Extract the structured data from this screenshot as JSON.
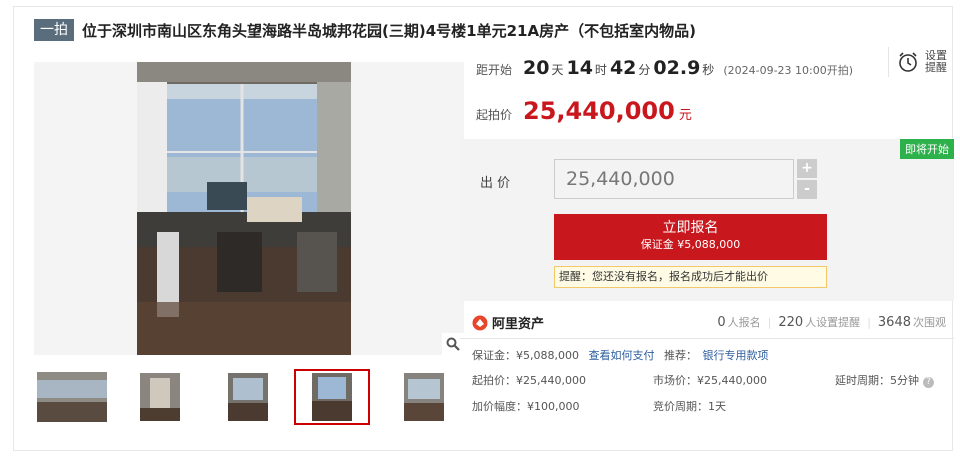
{
  "header": {
    "badge": "一拍",
    "title": "位于深圳市南山区东角头望海路半岛城邦花园(三期)4号楼1单元21A房产（不包括室内物品)"
  },
  "countdown": {
    "label": "距开始",
    "days": "20",
    "days_unit": "天",
    "hours": "14",
    "hours_unit": "时",
    "minutes": "42",
    "minutes_unit": "分",
    "seconds": "02.9",
    "seconds_unit": "秒",
    "start_note": "(2024-09-23 10:00开拍)"
  },
  "remind": {
    "line1": "设置",
    "line2": "提醒"
  },
  "start_price": {
    "label": "起拍价",
    "value": "25,440,000",
    "unit": "元"
  },
  "bid": {
    "status": "即将开始",
    "label": "出 价",
    "value": "25,440,000",
    "plus": "+",
    "minus": "-"
  },
  "apply": {
    "title": "立即报名",
    "deposit": "保证金 ¥5,088,000"
  },
  "tip": "提醒：您还没有报名，报名成功后才能出价",
  "platform": {
    "name": "阿里资产"
  },
  "stats": {
    "signups": "0",
    "signups_label": "人报名",
    "reminders": "220",
    "reminders_label": "人设置提醒",
    "views": "3648",
    "views_label": "次围观"
  },
  "info": {
    "deposit": "保证金：¥5,088,000",
    "how_to_pay": "查看如何支付",
    "recommend": "推荐：",
    "bank_account": "银行专用款项",
    "start_price": "起拍价：¥25,440,000",
    "market_price": "市场价：¥25,440,000",
    "delay": "延时周期：5分钟",
    "increment": "加价幅度：¥100,000",
    "bid_cycle": "竞价周期：1天"
  },
  "gallery": {
    "count": 5,
    "selected": 4
  },
  "colors": {
    "accent": "#c9171e",
    "badge": "#5a6d7d",
    "status": "#2db14b",
    "link": "#2c5d9e"
  }
}
